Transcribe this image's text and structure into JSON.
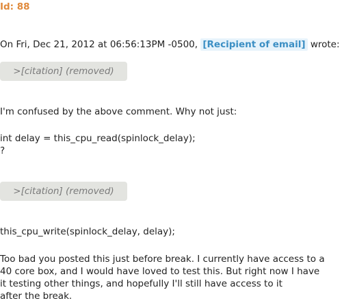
{
  "header": {
    "id_label": "Id: 88"
  },
  "email": {
    "intro_prefix": "On Fri, Dec 21, 2012 at 06:56:13PM -0500,",
    "recipient": "[Recipient of email]",
    "intro_suffix": "wrote:",
    "citation_1": ">[citation] (removed)",
    "line_confused": "I'm confused by the above comment. Why not just:",
    "code_line_1": "int delay = this_cpu_read(spinlock_delay);",
    "question_mark": "?",
    "citation_2": ">[citation] (removed)",
    "code_line_2": "this_cpu_write(spinlock_delay, delay);",
    "paragraph_lines": [
      "Too bad you posted this just before break. I currently have access to a",
      "40 core box, and I would have loved to test this. But right now I have",
      "it testing other things, and hopefully I'll still have access to it",
      "after the break."
    ]
  },
  "colors": {
    "id_label": "#e08a3c",
    "recipient_text": "#3b8fc4",
    "recipient_bg": "#e6f3fb",
    "citation_bg": "#e3e4e0",
    "citation_text": "#7a7a7a"
  }
}
